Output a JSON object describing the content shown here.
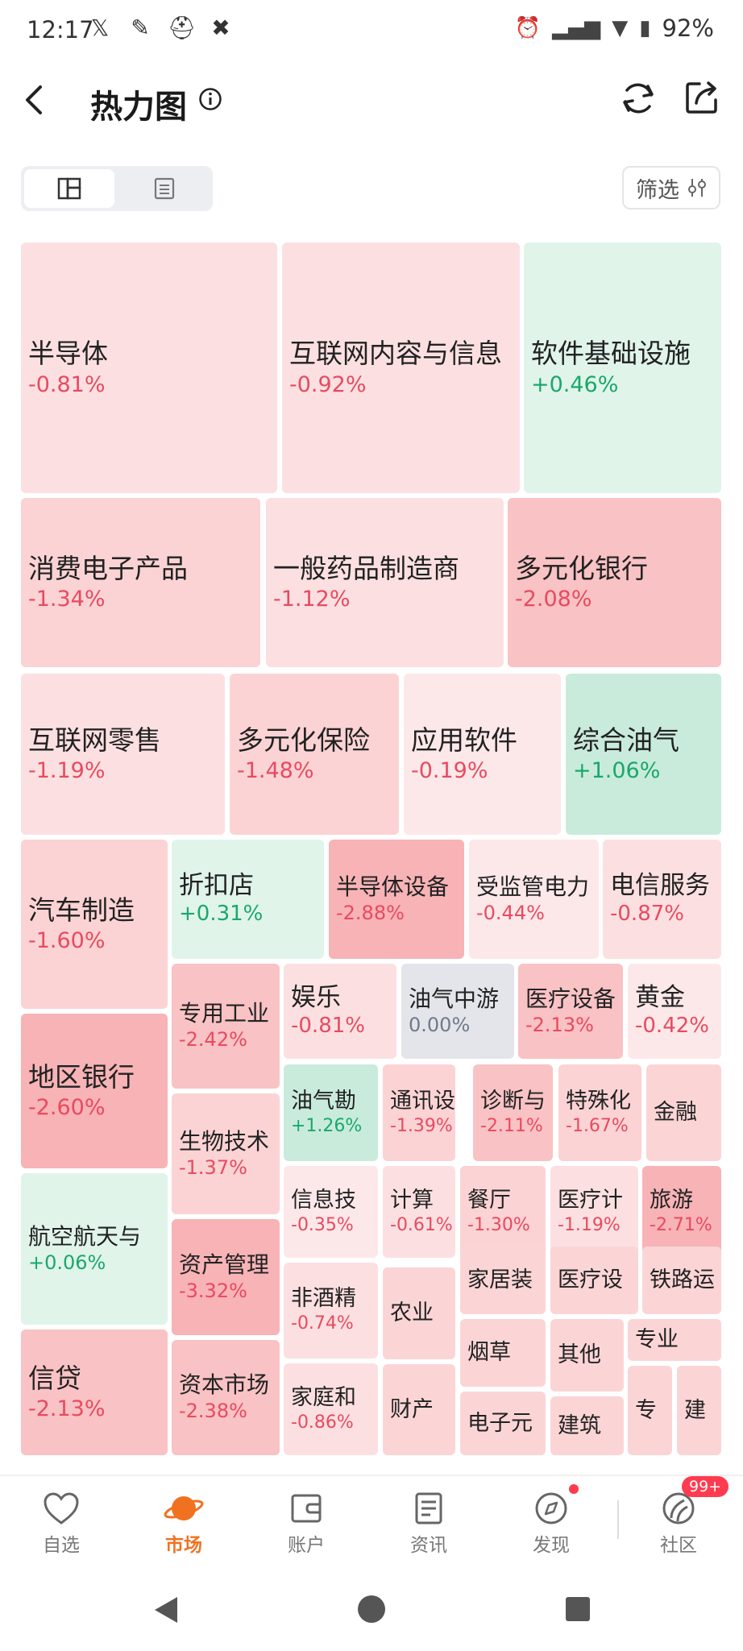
{
  "status": {
    "time": "12:17",
    "battery": "92%"
  },
  "header": {
    "title": "热力图"
  },
  "toolbar": {
    "filter_label": "筛选"
  },
  "colors": {
    "neg_text": "#e84a5f",
    "pos_text": "#1aa86a",
    "accent": "#f07220"
  },
  "tiles": [
    {
      "name": "半导体",
      "pct": "-0.81%"
    },
    {
      "name": "互联网内容与信息",
      "pct": "-0.92%"
    },
    {
      "name": "软件基础设施",
      "pct": "+0.46%"
    },
    {
      "name": "消费电子产品",
      "pct": "-1.34%"
    },
    {
      "name": "一般药品制造商",
      "pct": "-1.12%"
    },
    {
      "name": "多元化银行",
      "pct": "-2.08%"
    },
    {
      "name": "互联网零售",
      "pct": "-1.19%"
    },
    {
      "name": "多元化保险",
      "pct": "-1.48%"
    },
    {
      "name": "应用软件",
      "pct": "-0.19%"
    },
    {
      "name": "综合油气",
      "pct": "+1.06%"
    },
    {
      "name": "汽车制造",
      "pct": "-1.60%"
    },
    {
      "name": "折扣店",
      "pct": "+0.31%"
    },
    {
      "name": "半导体设备",
      "pct": "-2.88%"
    },
    {
      "name": "受监管电力",
      "pct": "-0.44%"
    },
    {
      "name": "电信服务",
      "pct": "-0.87%"
    },
    {
      "name": "专用工业",
      "pct": "-2.42%"
    },
    {
      "name": "娱乐",
      "pct": "-0.81%"
    },
    {
      "name": "油气中游",
      "pct": "0.00%"
    },
    {
      "name": "医疗设备",
      "pct": "-2.13%"
    },
    {
      "name": "黄金",
      "pct": "-0.42%"
    },
    {
      "name": "地区银行",
      "pct": "-2.60%"
    },
    {
      "name": "生物技术",
      "pct": "-1.37%"
    },
    {
      "name": "油气勘",
      "pct": "+1.26%"
    },
    {
      "name": "通讯设",
      "pct": "-1.39%"
    },
    {
      "name": "诊断与",
      "pct": "-2.11%"
    },
    {
      "name": "特殊化",
      "pct": "-1.67%"
    },
    {
      "name": "金融",
      "pct": ""
    },
    {
      "name": "航空航天与",
      "pct": "+0.06%"
    },
    {
      "name": "资产管理",
      "pct": "-3.32%"
    },
    {
      "name": "信息技",
      "pct": "-0.35%"
    },
    {
      "name": "计算",
      "pct": "-0.61%"
    },
    {
      "name": "餐厅",
      "pct": "-1.30%"
    },
    {
      "name": "医疗计",
      "pct": "-1.19%"
    },
    {
      "name": "旅游",
      "pct": "-2.71%"
    },
    {
      "name": "非酒精",
      "pct": "-0.74%"
    },
    {
      "name": "农业",
      "pct": ""
    },
    {
      "name": "家居装",
      "pct": ""
    },
    {
      "name": "医疗设",
      "pct": ""
    },
    {
      "name": "铁路运",
      "pct": ""
    },
    {
      "name": "烟草",
      "pct": ""
    },
    {
      "name": "其他",
      "pct": ""
    },
    {
      "name": "专业",
      "pct": ""
    },
    {
      "name": "信贷",
      "pct": "-2.13%"
    },
    {
      "name": "资本市场",
      "pct": "-2.38%"
    },
    {
      "name": "家庭和",
      "pct": "-0.86%"
    },
    {
      "name": "财产",
      "pct": ""
    },
    {
      "name": "电子元",
      "pct": ""
    },
    {
      "name": "建筑",
      "pct": ""
    },
    {
      "name": "专",
      "pct": ""
    },
    {
      "name": "建",
      "pct": ""
    }
  ],
  "tabs": [
    {
      "label": "自选"
    },
    {
      "label": "市场"
    },
    {
      "label": "账户"
    },
    {
      "label": "资讯"
    },
    {
      "label": "发现"
    },
    {
      "label": "社区"
    }
  ],
  "community_badge": "99+"
}
